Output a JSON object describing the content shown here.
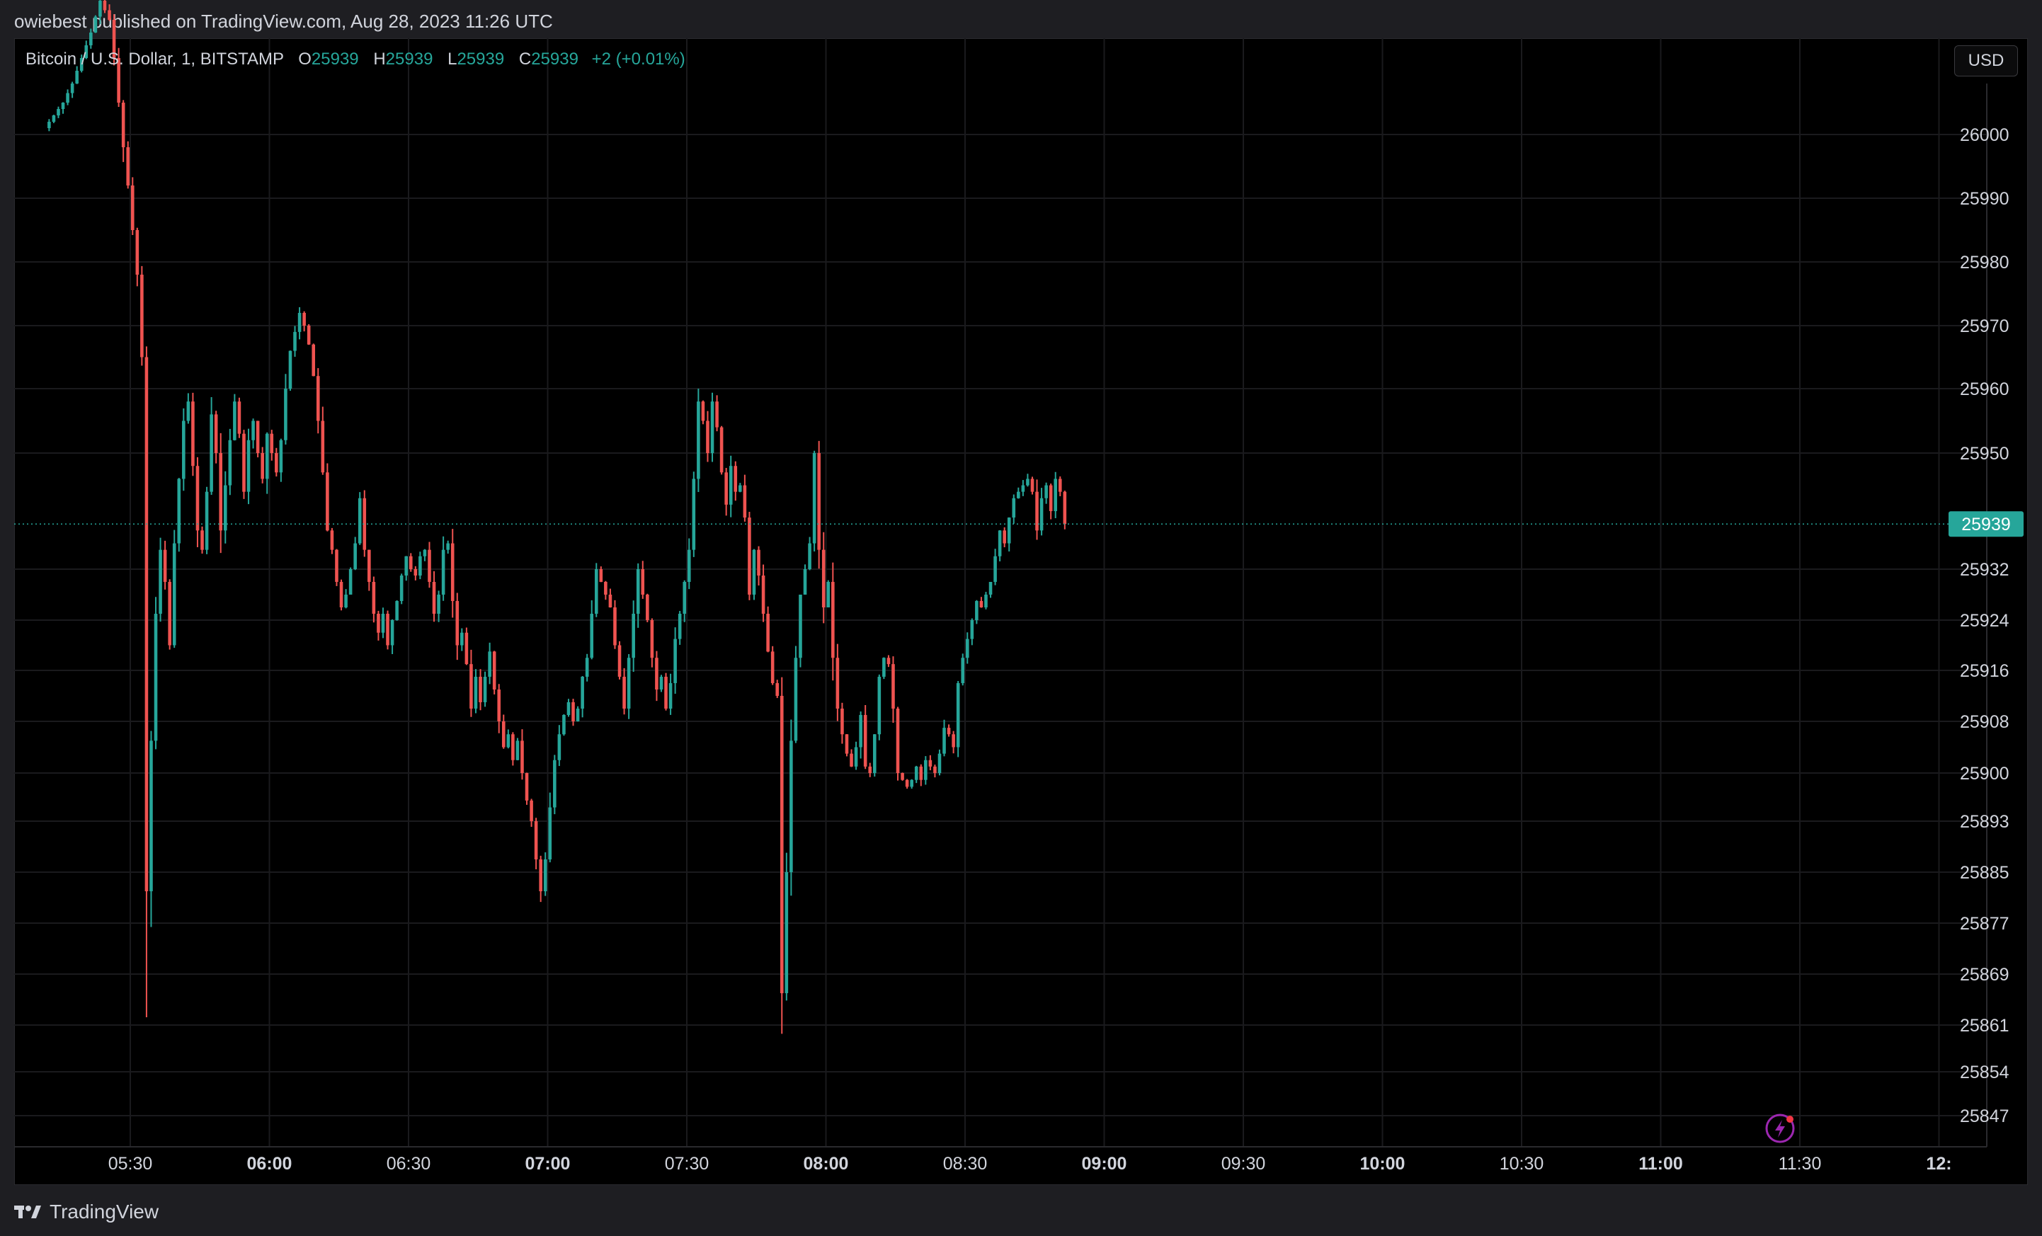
{
  "header": {
    "published_text": "owiebest published on TradingView.com, Aug 28, 2023 11:26 UTC"
  },
  "legend": {
    "symbol": "Bitcoin / U.S. Dollar, 1, BITSTAMP",
    "open_label": "O",
    "open": "25939",
    "high_label": "H",
    "high": "25939",
    "low_label": "L",
    "low": "25939",
    "close_label": "C",
    "close": "25939",
    "change": "+2 (+0.01%)"
  },
  "currency_button": "USD",
  "footer": {
    "logo_text": "TradingView"
  },
  "colors": {
    "up": "#26a69a",
    "down": "#ef5350",
    "background": "#000000",
    "grid": "#1a1a1d",
    "price_line": "#26a69a"
  },
  "icons": {
    "footer_logo": "tradingview-logo-icon",
    "bolt": "lightning-icon"
  },
  "chart_data": {
    "type": "candlestick",
    "symbol": "Bitcoin / U.S. Dollar",
    "interval": "1",
    "exchange": "BITSTAMP",
    "current_price": 25939,
    "y_ticks": [
      26000,
      25990,
      25980,
      25970,
      25960,
      25950,
      25932,
      25924,
      25916,
      25908,
      25900,
      25893,
      25885,
      25877,
      25869,
      25861,
      25854,
      25847
    ],
    "x_ticks": [
      {
        "label": "05:30",
        "bold": false,
        "minutes": 330
      },
      {
        "label": "06:00",
        "bold": true,
        "minutes": 360
      },
      {
        "label": "06:30",
        "bold": false,
        "minutes": 390
      },
      {
        "label": "07:00",
        "bold": true,
        "minutes": 420
      },
      {
        "label": "07:30",
        "bold": false,
        "minutes": 450
      },
      {
        "label": "08:00",
        "bold": true,
        "minutes": 480
      },
      {
        "label": "08:30",
        "bold": false,
        "minutes": 510
      },
      {
        "label": "09:00",
        "bold": true,
        "minutes": 540
      },
      {
        "label": "09:30",
        "bold": false,
        "minutes": 570
      },
      {
        "label": "10:00",
        "bold": true,
        "minutes": 600
      },
      {
        "label": "10:30",
        "bold": false,
        "minutes": 630
      },
      {
        "label": "11:00",
        "bold": true,
        "minutes": 660
      },
      {
        "label": "11:30",
        "bold": false,
        "minutes": 690
      },
      {
        "label": "12:",
        "bold": true,
        "minutes": 720
      }
    ],
    "path": [
      [
        312,
        26001
      ],
      [
        314,
        26003
      ],
      [
        316,
        26005
      ],
      [
        318,
        26008
      ],
      [
        320,
        26012
      ],
      [
        322,
        26016
      ],
      [
        324,
        26021
      ],
      [
        326,
        26018
      ],
      [
        327,
        26012
      ],
      [
        328,
        26005
      ],
      [
        329,
        25998
      ],
      [
        330,
        25992
      ],
      [
        331,
        25985
      ],
      [
        332,
        25978
      ],
      [
        333,
        25965
      ],
      [
        334,
        25882
      ],
      [
        335,
        25905
      ],
      [
        336,
        25925
      ],
      [
        337,
        25935
      ],
      [
        338,
        25930
      ],
      [
        339,
        25920
      ],
      [
        340,
        25936
      ],
      [
        341,
        25946
      ],
      [
        342,
        25955
      ],
      [
        343,
        25958
      ],
      [
        344,
        25948
      ],
      [
        345,
        25938
      ],
      [
        346,
        25935
      ],
      [
        347,
        25944
      ],
      [
        348,
        25956
      ],
      [
        349,
        25950
      ],
      [
        350,
        25938
      ],
      [
        351,
        25945
      ],
      [
        352,
        25952
      ],
      [
        353,
        25958
      ],
      [
        354,
        25953
      ],
      [
        355,
        25944
      ],
      [
        356,
        25952
      ],
      [
        357,
        25955
      ],
      [
        358,
        25950
      ],
      [
        359,
        25946
      ],
      [
        360,
        25953
      ],
      [
        361,
        25950
      ],
      [
        362,
        25947
      ],
      [
        363,
        25952
      ],
      [
        364,
        25960
      ],
      [
        365,
        25966
      ],
      [
        366,
        25969
      ],
      [
        367,
        25972
      ],
      [
        368,
        25970
      ],
      [
        369,
        25967
      ],
      [
        370,
        25962
      ],
      [
        371,
        25955
      ],
      [
        372,
        25947
      ],
      [
        373,
        25938
      ],
      [
        374,
        25935
      ],
      [
        375,
        25930
      ],
      [
        376,
        25926
      ],
      [
        377,
        25928
      ],
      [
        378,
        25932
      ],
      [
        379,
        25936
      ],
      [
        380,
        25943
      ],
      [
        381,
        25935
      ],
      [
        382,
        25930
      ],
      [
        383,
        25925
      ],
      [
        384,
        25922
      ],
      [
        385,
        25925
      ],
      [
        386,
        25920
      ],
      [
        387,
        25924
      ],
      [
        388,
        25927
      ],
      [
        389,
        25931
      ],
      [
        390,
        25934
      ],
      [
        391,
        25932
      ],
      [
        392,
        25931
      ],
      [
        393,
        25934
      ],
      [
        394,
        25935
      ],
      [
        395,
        25930
      ],
      [
        396,
        25925
      ],
      [
        397,
        25928
      ],
      [
        398,
        25935
      ],
      [
        399,
        25936
      ],
      [
        400,
        25927
      ],
      [
        401,
        25920
      ],
      [
        402,
        25922
      ],
      [
        403,
        25917
      ],
      [
        404,
        25910
      ],
      [
        405,
        25915
      ],
      [
        406,
        25911
      ],
      [
        407,
        25915
      ],
      [
        408,
        25919
      ],
      [
        409,
        25913
      ],
      [
        410,
        25908
      ],
      [
        411,
        25904
      ],
      [
        412,
        25906
      ],
      [
        413,
        25902
      ],
      [
        414,
        25905
      ],
      [
        415,
        25900
      ],
      [
        416,
        25896
      ],
      [
        417,
        25893
      ],
      [
        418,
        25887
      ],
      [
        419,
        25882
      ],
      [
        420,
        25887
      ],
      [
        421,
        25895
      ],
      [
        422,
        25902
      ],
      [
        423,
        25906
      ],
      [
        424,
        25909
      ],
      [
        425,
        25911
      ],
      [
        426,
        25908
      ],
      [
        427,
        25910
      ],
      [
        428,
        25915
      ],
      [
        429,
        25918
      ],
      [
        430,
        25925
      ],
      [
        431,
        25932
      ],
      [
        432,
        25930
      ],
      [
        433,
        25928
      ],
      [
        434,
        25926
      ],
      [
        435,
        25920
      ],
      [
        436,
        25915
      ],
      [
        437,
        25910
      ],
      [
        438,
        25918
      ],
      [
        439,
        25925
      ],
      [
        440,
        25932
      ],
      [
        441,
        25928
      ],
      [
        442,
        25924
      ],
      [
        443,
        25918
      ],
      [
        444,
        25913
      ],
      [
        445,
        25915
      ],
      [
        446,
        25910
      ],
      [
        447,
        25914
      ],
      [
        448,
        25921
      ],
      [
        449,
        25925
      ],
      [
        450,
        25930
      ],
      [
        451,
        25935
      ],
      [
        452,
        25946
      ],
      [
        453,
        25958
      ],
      [
        454,
        25955
      ],
      [
        455,
        25950
      ],
      [
        456,
        25958
      ],
      [
        457,
        25954
      ],
      [
        458,
        25947
      ],
      [
        459,
        25942
      ],
      [
        460,
        25948
      ],
      [
        461,
        25944
      ],
      [
        462,
        25945
      ],
      [
        463,
        25940
      ],
      [
        464,
        25928
      ],
      [
        465,
        25935
      ],
      [
        466,
        25931
      ],
      [
        467,
        25925
      ],
      [
        468,
        25919
      ],
      [
        469,
        25914
      ],
      [
        470,
        25912
      ],
      [
        471,
        25866
      ],
      [
        472,
        25885
      ],
      [
        473,
        25905
      ],
      [
        474,
        25918
      ],
      [
        475,
        25928
      ],
      [
        476,
        25932
      ],
      [
        477,
        25936
      ],
      [
        478,
        25950
      ],
      [
        479,
        25935
      ],
      [
        480,
        25926
      ],
      [
        481,
        25930
      ],
      [
        482,
        25918
      ],
      [
        483,
        25910
      ],
      [
        484,
        25906
      ],
      [
        485,
        25903
      ],
      [
        486,
        25901
      ],
      [
        487,
        25904
      ],
      [
        488,
        25909
      ],
      [
        489,
        25901
      ],
      [
        490,
        25900
      ],
      [
        491,
        25906
      ],
      [
        492,
        25915
      ],
      [
        493,
        25918
      ],
      [
        494,
        25917
      ],
      [
        495,
        25910
      ],
      [
        496,
        25900
      ],
      [
        497,
        25899
      ],
      [
        498,
        25898
      ],
      [
        499,
        25899
      ],
      [
        500,
        25901
      ],
      [
        501,
        25899
      ],
      [
        502,
        25902
      ],
      [
        503,
        25901
      ],
      [
        504,
        25900
      ],
      [
        505,
        25903
      ],
      [
        506,
        25907
      ],
      [
        507,
        25906
      ],
      [
        508,
        25904
      ],
      [
        509,
        25914
      ],
      [
        510,
        25918
      ],
      [
        511,
        25921
      ],
      [
        512,
        25924
      ],
      [
        513,
        25927
      ],
      [
        514,
        25926
      ],
      [
        515,
        25928
      ],
      [
        516,
        25930
      ],
      [
        517,
        25934
      ],
      [
        518,
        25938
      ],
      [
        519,
        25936
      ],
      [
        520,
        25940
      ],
      [
        521,
        25943
      ],
      [
        522,
        25944
      ],
      [
        523,
        25945
      ],
      [
        524,
        25946
      ],
      [
        525,
        25944
      ],
      [
        526,
        25938
      ],
      [
        527,
        25943
      ],
      [
        528,
        25945
      ],
      [
        529,
        25941
      ],
      [
        530,
        25946
      ],
      [
        531,
        25944
      ],
      [
        532,
        25939
      ]
    ]
  }
}
